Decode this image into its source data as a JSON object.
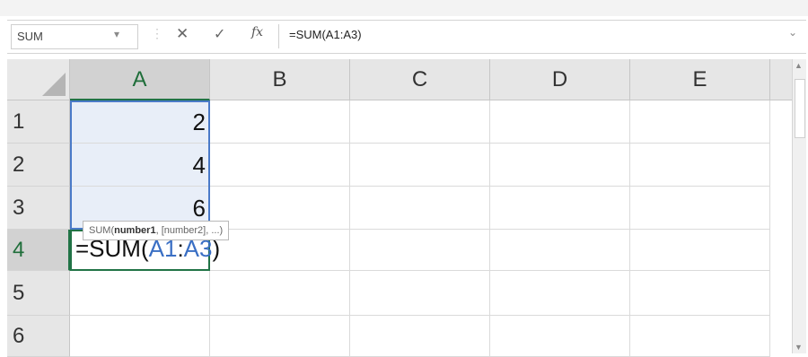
{
  "formula_bar": {
    "name_box": "SUM",
    "name_box_arrow": "▾",
    "separator": "⋮",
    "cancel_glyph": "✕",
    "enter_glyph": "✓",
    "fx_label": "fx",
    "formula": "=SUM(A1:A3)",
    "expand_glyph": "⌄"
  },
  "columns": [
    "A",
    "B",
    "C",
    "D",
    "E"
  ],
  "rows": [
    "1",
    "2",
    "3",
    "4",
    "5",
    "6"
  ],
  "cells": {
    "a1": "2",
    "a2": "4",
    "a3": "6"
  },
  "active_cell": {
    "prefix": "=SUM(",
    "ref_start": "A1",
    "colon": ":",
    "ref_end": "A3",
    "suffix": ")"
  },
  "tooltip": {
    "func": "SUM(",
    "arg1": "number1",
    "rest": ", [number2], ...)"
  },
  "colors": {
    "selection_green": "#217346",
    "reference_blue": "#3a6fc4",
    "range_fill": "#e8eef8"
  },
  "icons": [
    "cancel-icon",
    "enter-icon",
    "fx-icon",
    "dropdown-arrow-icon",
    "expand-icon"
  ]
}
